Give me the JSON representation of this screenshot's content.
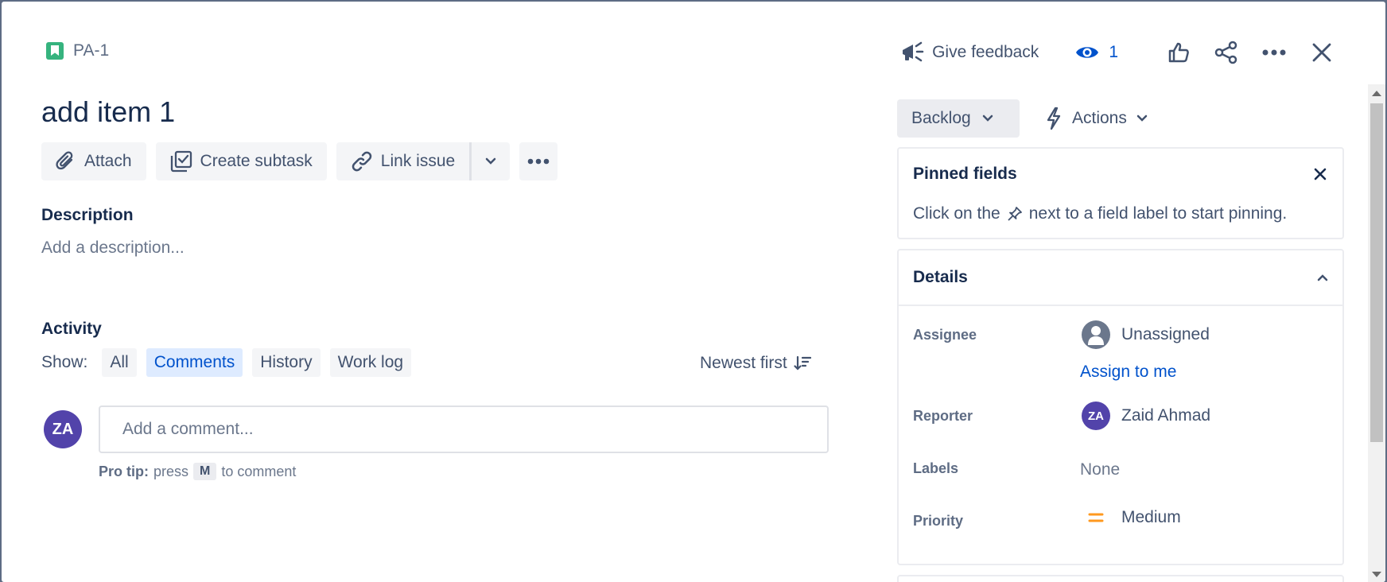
{
  "header": {
    "issue_key": "PA-1",
    "give_feedback": "Give feedback",
    "watchers_count": "1"
  },
  "issue": {
    "title": "add item 1"
  },
  "toolbar": {
    "attach": "Attach",
    "create_subtask": "Create subtask",
    "link_issue": "Link issue"
  },
  "description": {
    "label": "Description",
    "placeholder": "Add a description..."
  },
  "activity": {
    "label": "Activity",
    "show_label": "Show:",
    "filters": [
      "All",
      "Comments",
      "History",
      "Work log"
    ],
    "active_filter": "Comments",
    "sort": "Newest first"
  },
  "comment": {
    "avatar_initials": "ZA",
    "placeholder": "Add a comment...",
    "protip_prefix": "Pro tip:",
    "protip_press": "press",
    "protip_key": "M",
    "protip_suffix": "to comment"
  },
  "sidebar": {
    "status": "Backlog",
    "actions": "Actions",
    "pinned": {
      "title": "Pinned fields",
      "text_before": "Click on the",
      "text_after": "next to a field label to start pinning."
    },
    "details": {
      "title": "Details",
      "assignee_label": "Assignee",
      "assignee_value": "Unassigned",
      "assign_to_me": "Assign to me",
      "reporter_label": "Reporter",
      "reporter_initials": "ZA",
      "reporter_value": "Zaid Ahmad",
      "labels_label": "Labels",
      "labels_value": "None",
      "priority_label": "Priority",
      "priority_value": "Medium"
    }
  },
  "colors": {
    "brand_blue": "#0052cc",
    "story_green": "#36b37e",
    "avatar_purple": "#5243aa",
    "priority_orange": "#ff991f"
  }
}
